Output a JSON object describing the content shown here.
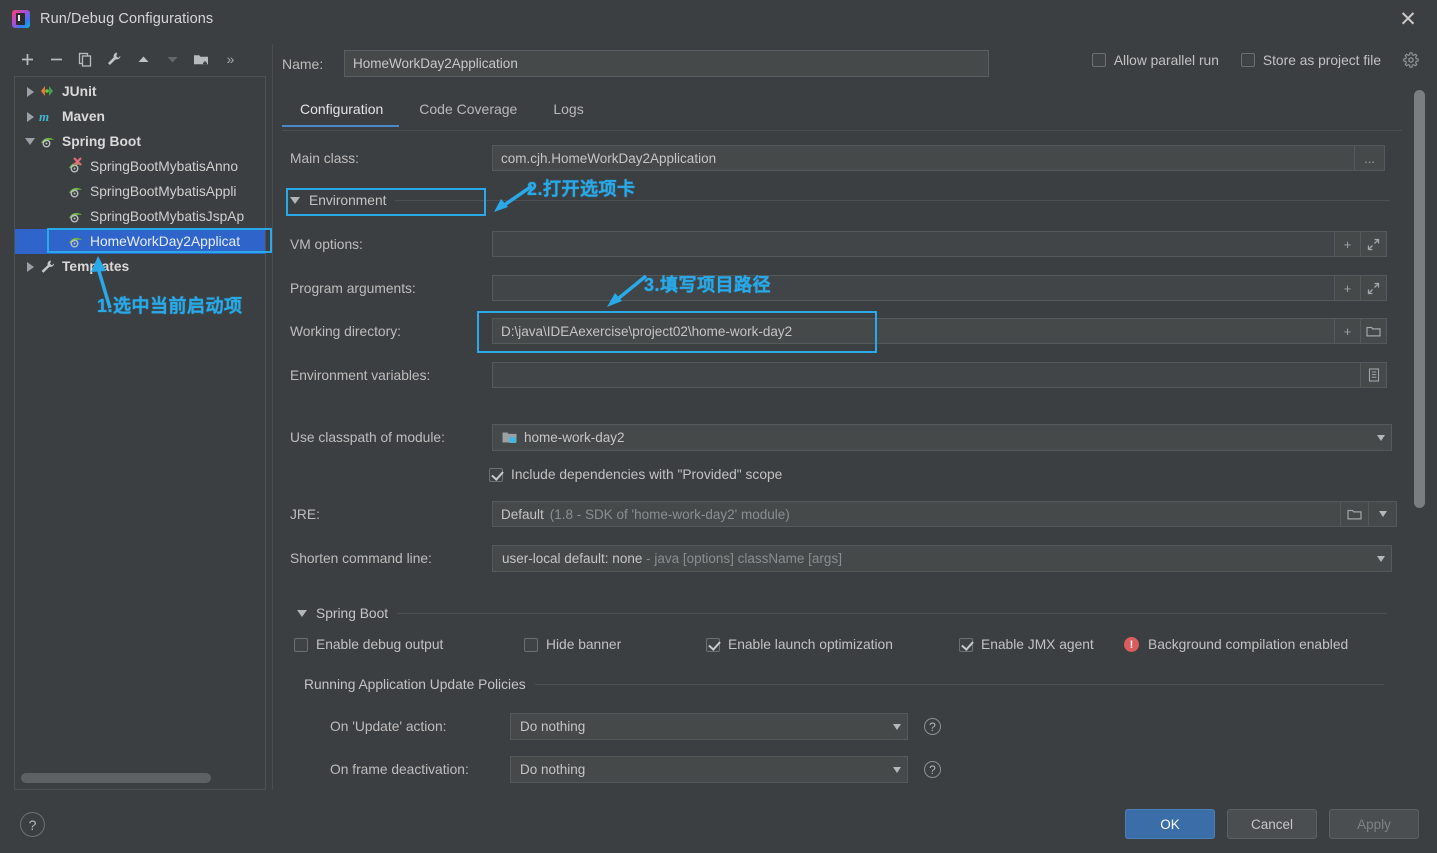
{
  "window": {
    "title": "Run/Debug Configurations",
    "app_icon": "intellij-idea-icon",
    "close_label": "✕"
  },
  "toolbar": {
    "buttons": [
      {
        "name": "add-configuration-button",
        "icon": "plus-icon",
        "label": "+"
      },
      {
        "name": "remove-configuration-button",
        "icon": "minus-icon",
        "label": "−"
      },
      {
        "name": "copy-configuration-button",
        "icon": "copy-icon",
        "label": "copy"
      },
      {
        "name": "edit-templates-button",
        "icon": "wrench-icon",
        "label": "wrench"
      },
      {
        "name": "move-up-button",
        "icon": "arrow-up-icon",
        "label": "up"
      },
      {
        "name": "move-down-button",
        "icon": "arrow-down-icon",
        "label": "down"
      },
      {
        "name": "new-folder-button",
        "icon": "folder-add-icon",
        "label": "folder"
      },
      {
        "name": "more-options-button",
        "icon": "chevron-double-right-icon",
        "label": "»"
      }
    ]
  },
  "tree": {
    "items": [
      {
        "label": "JUnit",
        "icon": "junit-icon",
        "depth": 0,
        "expandable": true,
        "expanded": false,
        "bold": true,
        "selected": false
      },
      {
        "label": "Maven",
        "icon": "maven-icon",
        "depth": 0,
        "expandable": true,
        "expanded": false,
        "bold": true,
        "selected": false
      },
      {
        "label": "Spring Boot",
        "icon": "spring-boot-icon",
        "depth": 0,
        "expandable": true,
        "expanded": true,
        "bold": true,
        "selected": false
      },
      {
        "label": "SpringBootMybatisAnno",
        "icon": "spring-boot-run-icon",
        "depth": 1,
        "expandable": false,
        "expanded": false,
        "bold": false,
        "selected": false
      },
      {
        "label": "SpringBootMybatisAppli",
        "icon": "spring-boot-run-icon",
        "depth": 1,
        "expandable": false,
        "expanded": false,
        "bold": false,
        "selected": false
      },
      {
        "label": "SpringBootMybatisJspAp",
        "icon": "spring-boot-run-icon",
        "depth": 1,
        "expandable": false,
        "expanded": false,
        "bold": false,
        "selected": false
      },
      {
        "label": "HomeWorkDay2Applicat",
        "icon": "spring-boot-run-icon",
        "depth": 1,
        "expandable": false,
        "expanded": false,
        "bold": false,
        "selected": true
      },
      {
        "label": "Templates",
        "icon": "wrench-icon",
        "depth": 0,
        "expandable": true,
        "expanded": false,
        "bold": true,
        "selected": false
      }
    ]
  },
  "annotations": {
    "color": "#29a9e8",
    "items": [
      {
        "name": "annotation-select-config",
        "text": "1.选中当前启动项"
      },
      {
        "name": "annotation-open-tab",
        "text": "2.打开选项卡"
      },
      {
        "name": "annotation-fill-path",
        "text": "3.填写项目路径"
      }
    ]
  },
  "name_field": {
    "label": "Name:",
    "value": "HomeWorkDay2Application"
  },
  "top_options": {
    "allow_parallel_run": {
      "label": "Allow parallel run",
      "checked": false
    },
    "store_as_project_file": {
      "label": "Store as project file",
      "checked": false
    },
    "gear_icon": "gear-icon"
  },
  "tabs": [
    {
      "label": "Configuration",
      "active": true
    },
    {
      "label": "Code Coverage",
      "active": false
    },
    {
      "label": "Logs",
      "active": false
    }
  ],
  "configuration": {
    "main_class": {
      "label": "Main class:",
      "value": "com.cjh.HomeWorkDay2Application",
      "browse_label": "..."
    },
    "environment_section": {
      "label": "Environment",
      "expanded": true
    },
    "vm_options": {
      "label": "VM options:",
      "value": "",
      "btn_add": "+",
      "btn_expand": "expand-icon"
    },
    "program_arguments": {
      "label": "Program arguments:",
      "value": "",
      "btn_add": "+",
      "btn_expand": "expand-icon"
    },
    "working_directory": {
      "label": "Working directory:",
      "value": "D:\\java\\IDEAexercise\\project02\\home-work-day2",
      "btn_add": "+",
      "btn_folder": "folder-icon"
    },
    "environment_variables": {
      "label": "Environment variables:",
      "value": "",
      "btn_list": "list-icon"
    },
    "use_classpath_of_module": {
      "label": "Use classpath of module:",
      "value": "home-work-day2",
      "icon": "module-icon"
    },
    "include_provided": {
      "label": "Include dependencies with \"Provided\" scope",
      "checked": true
    },
    "jre": {
      "label": "JRE:",
      "value": "Default",
      "hint": "(1.8 - SDK of 'home-work-day2' module)",
      "btn_folder": "folder-icon"
    },
    "shorten_command_line": {
      "label": "Shorten command line:",
      "value": "user-local default: none",
      "hint": "- java [options] className [args]"
    }
  },
  "spring_boot": {
    "section_label": "Spring Boot",
    "checkboxes": [
      {
        "label": "Enable debug output",
        "checked": false
      },
      {
        "label": "Hide banner",
        "checked": false
      },
      {
        "label": "Enable launch optimization",
        "checked": true
      },
      {
        "label": "Enable JMX agent",
        "checked": true
      }
    ],
    "warning": {
      "icon": "error-icon",
      "text": "Background compilation enabled"
    },
    "update_policies": {
      "section_label": "Running Application Update Policies",
      "rows": [
        {
          "label": "On 'Update' action:",
          "value": "Do nothing",
          "help": "?"
        },
        {
          "label": "On frame deactivation:",
          "value": "Do nothing",
          "help": "?"
        }
      ]
    }
  },
  "footer": {
    "help_label": "?",
    "buttons": [
      {
        "label": "OK",
        "style": "primary",
        "enabled": true
      },
      {
        "label": "Cancel",
        "style": "normal",
        "enabled": true
      },
      {
        "label": "Apply",
        "style": "normal",
        "enabled": false
      }
    ]
  }
}
